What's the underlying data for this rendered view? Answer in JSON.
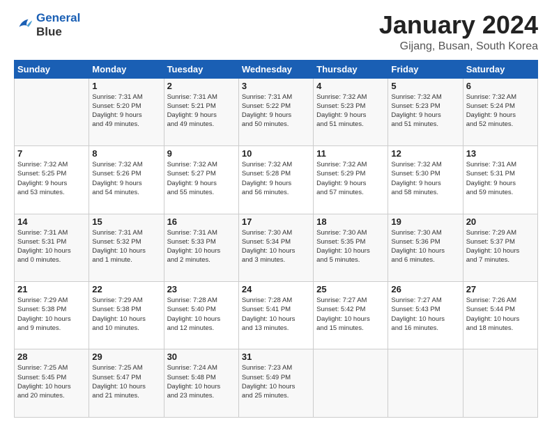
{
  "header": {
    "logo_line1": "General",
    "logo_line2": "Blue",
    "month": "January 2024",
    "location": "Gijang, Busan, South Korea"
  },
  "days_of_week": [
    "Sunday",
    "Monday",
    "Tuesday",
    "Wednesday",
    "Thursday",
    "Friday",
    "Saturday"
  ],
  "weeks": [
    [
      {
        "day": "",
        "info": ""
      },
      {
        "day": "1",
        "info": "Sunrise: 7:31 AM\nSunset: 5:20 PM\nDaylight: 9 hours\nand 49 minutes."
      },
      {
        "day": "2",
        "info": "Sunrise: 7:31 AM\nSunset: 5:21 PM\nDaylight: 9 hours\nand 49 minutes."
      },
      {
        "day": "3",
        "info": "Sunrise: 7:31 AM\nSunset: 5:22 PM\nDaylight: 9 hours\nand 50 minutes."
      },
      {
        "day": "4",
        "info": "Sunrise: 7:32 AM\nSunset: 5:23 PM\nDaylight: 9 hours\nand 51 minutes."
      },
      {
        "day": "5",
        "info": "Sunrise: 7:32 AM\nSunset: 5:23 PM\nDaylight: 9 hours\nand 51 minutes."
      },
      {
        "day": "6",
        "info": "Sunrise: 7:32 AM\nSunset: 5:24 PM\nDaylight: 9 hours\nand 52 minutes."
      }
    ],
    [
      {
        "day": "7",
        "info": "Sunrise: 7:32 AM\nSunset: 5:25 PM\nDaylight: 9 hours\nand 53 minutes."
      },
      {
        "day": "8",
        "info": "Sunrise: 7:32 AM\nSunset: 5:26 PM\nDaylight: 9 hours\nand 54 minutes."
      },
      {
        "day": "9",
        "info": "Sunrise: 7:32 AM\nSunset: 5:27 PM\nDaylight: 9 hours\nand 55 minutes."
      },
      {
        "day": "10",
        "info": "Sunrise: 7:32 AM\nSunset: 5:28 PM\nDaylight: 9 hours\nand 56 minutes."
      },
      {
        "day": "11",
        "info": "Sunrise: 7:32 AM\nSunset: 5:29 PM\nDaylight: 9 hours\nand 57 minutes."
      },
      {
        "day": "12",
        "info": "Sunrise: 7:32 AM\nSunset: 5:30 PM\nDaylight: 9 hours\nand 58 minutes."
      },
      {
        "day": "13",
        "info": "Sunrise: 7:31 AM\nSunset: 5:31 PM\nDaylight: 9 hours\nand 59 minutes."
      }
    ],
    [
      {
        "day": "14",
        "info": "Sunrise: 7:31 AM\nSunset: 5:31 PM\nDaylight: 10 hours\nand 0 minutes."
      },
      {
        "day": "15",
        "info": "Sunrise: 7:31 AM\nSunset: 5:32 PM\nDaylight: 10 hours\nand 1 minute."
      },
      {
        "day": "16",
        "info": "Sunrise: 7:31 AM\nSunset: 5:33 PM\nDaylight: 10 hours\nand 2 minutes."
      },
      {
        "day": "17",
        "info": "Sunrise: 7:30 AM\nSunset: 5:34 PM\nDaylight: 10 hours\nand 3 minutes."
      },
      {
        "day": "18",
        "info": "Sunrise: 7:30 AM\nSunset: 5:35 PM\nDaylight: 10 hours\nand 5 minutes."
      },
      {
        "day": "19",
        "info": "Sunrise: 7:30 AM\nSunset: 5:36 PM\nDaylight: 10 hours\nand 6 minutes."
      },
      {
        "day": "20",
        "info": "Sunrise: 7:29 AM\nSunset: 5:37 PM\nDaylight: 10 hours\nand 7 minutes."
      }
    ],
    [
      {
        "day": "21",
        "info": "Sunrise: 7:29 AM\nSunset: 5:38 PM\nDaylight: 10 hours\nand 9 minutes."
      },
      {
        "day": "22",
        "info": "Sunrise: 7:29 AM\nSunset: 5:38 PM\nDaylight: 10 hours\nand 10 minutes."
      },
      {
        "day": "23",
        "info": "Sunrise: 7:28 AM\nSunset: 5:40 PM\nDaylight: 10 hours\nand 12 minutes."
      },
      {
        "day": "24",
        "info": "Sunrise: 7:28 AM\nSunset: 5:41 PM\nDaylight: 10 hours\nand 13 minutes."
      },
      {
        "day": "25",
        "info": "Sunrise: 7:27 AM\nSunset: 5:42 PM\nDaylight: 10 hours\nand 15 minutes."
      },
      {
        "day": "26",
        "info": "Sunrise: 7:27 AM\nSunset: 5:43 PM\nDaylight: 10 hours\nand 16 minutes."
      },
      {
        "day": "27",
        "info": "Sunrise: 7:26 AM\nSunset: 5:44 PM\nDaylight: 10 hours\nand 18 minutes."
      }
    ],
    [
      {
        "day": "28",
        "info": "Sunrise: 7:25 AM\nSunset: 5:45 PM\nDaylight: 10 hours\nand 20 minutes."
      },
      {
        "day": "29",
        "info": "Sunrise: 7:25 AM\nSunset: 5:47 PM\nDaylight: 10 hours\nand 21 minutes."
      },
      {
        "day": "30",
        "info": "Sunrise: 7:24 AM\nSunset: 5:48 PM\nDaylight: 10 hours\nand 23 minutes."
      },
      {
        "day": "31",
        "info": "Sunrise: 7:23 AM\nSunset: 5:49 PM\nDaylight: 10 hours\nand 25 minutes."
      },
      {
        "day": "",
        "info": ""
      },
      {
        "day": "",
        "info": ""
      },
      {
        "day": "",
        "info": ""
      }
    ]
  ]
}
